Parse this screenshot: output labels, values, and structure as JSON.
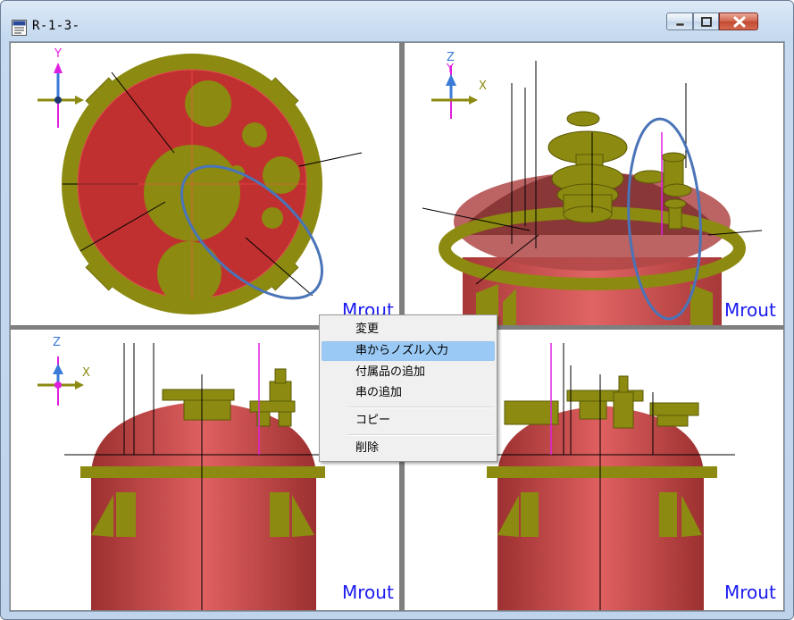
{
  "window": {
    "title": "R-1-3-",
    "icon": "dok-document-icon",
    "buttons": [
      "minimize",
      "maximize",
      "close"
    ]
  },
  "viewports": [
    {
      "view": "top",
      "axes": [
        "Y"
      ],
      "label": "Mrout"
    },
    {
      "view": "isometric",
      "axes": [
        "Z",
        "Y",
        "X"
      ],
      "label": "Mrout"
    },
    {
      "view": "front",
      "axes": [
        "Z",
        "X"
      ],
      "label": "Mrout"
    },
    {
      "view": "side",
      "axes": [],
      "label": "Mrout"
    }
  ],
  "context_menu": {
    "items": [
      {
        "label": "変更",
        "highlighted": false
      },
      {
        "label": "串からノズル入力",
        "highlighted": true
      },
      {
        "label": "付属品の追加",
        "highlighted": false
      },
      {
        "label": "串の追加",
        "highlighted": false
      },
      {
        "label": "コピー",
        "highlighted": false
      },
      {
        "label": "削除",
        "highlighted": false
      }
    ]
  },
  "colors": {
    "vessel_red": "#c03030",
    "nozzle_olive": "#8c8a10",
    "label_blue": "#1a1af0",
    "highlight_ellipse": "#4a74b8"
  }
}
